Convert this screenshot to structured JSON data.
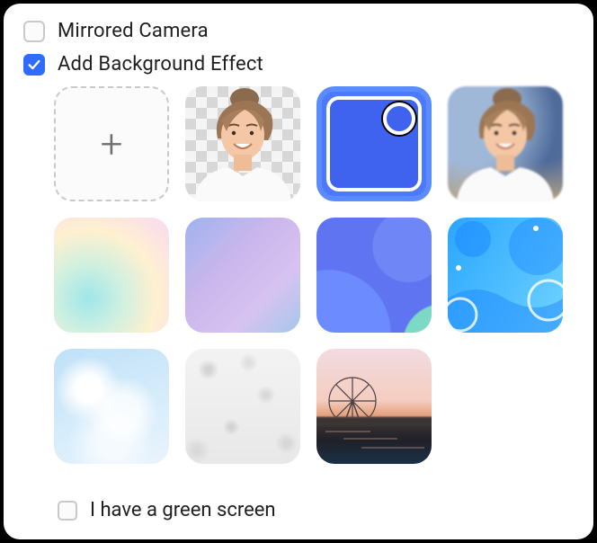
{
  "options": {
    "mirrored_camera": {
      "label": "Mirrored Camera",
      "checked": false
    },
    "add_bg_effect": {
      "label": "Add Background Effect",
      "checked": true
    },
    "green_screen": {
      "label": "I have a green screen",
      "checked": false
    }
  },
  "tiles": {
    "add": {
      "name": "add-custom-background"
    },
    "cutout": {
      "name": "no-background"
    },
    "solid": {
      "name": "solid-blue",
      "selected": true
    },
    "blur": {
      "name": "blur-background"
    },
    "pastel": {
      "name": "pastel-gradient"
    },
    "lilac": {
      "name": "lilac-gradient"
    },
    "wave": {
      "name": "blue-wave"
    },
    "shapes": {
      "name": "flat-blue-shapes"
    },
    "clouds": {
      "name": "light-clouds"
    },
    "concrete": {
      "name": "concrete-texture"
    },
    "sunset": {
      "name": "city-sunset"
    }
  }
}
